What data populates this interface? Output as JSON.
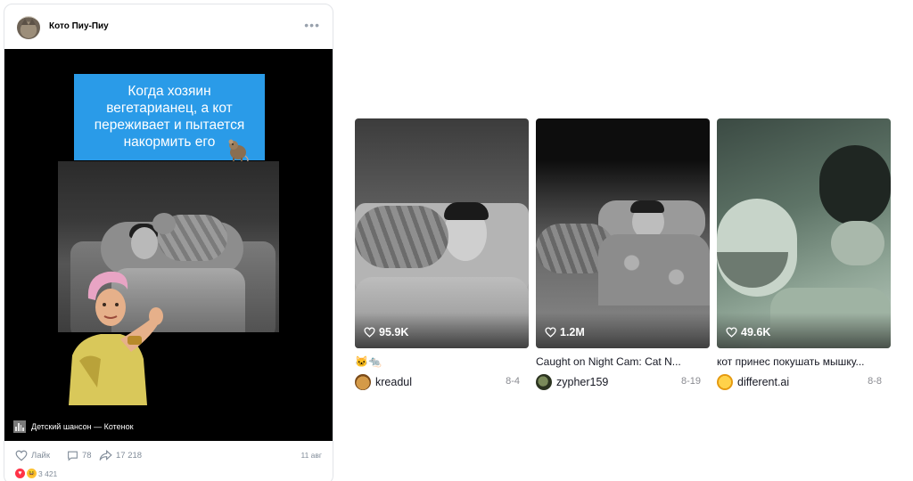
{
  "post": {
    "channel_name": "Кото Пиу-Пиу",
    "caption_lines": [
      "Когда хозяин",
      "вегетарианец, а кот",
      "переживает и пытается",
      "накормить его"
    ],
    "music": "Детский шансон — Котенок",
    "like_label": "Лайк",
    "comments_count": "78",
    "shares_count": "17 218",
    "date": "11 авг",
    "reactions_count": "3 421",
    "accent": "#2a9be8"
  },
  "tiktok": {
    "cards": [
      {
        "likes": "95.9K",
        "title": "🐱🐀",
        "username": "kreadul",
        "date": "8-4",
        "avatar_color": "#b07a2c"
      },
      {
        "likes": "1.2M",
        "title": "Caught on Night Cam: Cat N...",
        "username": "zypher159",
        "date": "8-19",
        "avatar_color": "#3b4a2f"
      },
      {
        "likes": "49.6K",
        "title": "кот принес покушать мышку...",
        "username": "different.ai",
        "date": "8-8",
        "avatar_color": "#f2b320"
      }
    ]
  }
}
